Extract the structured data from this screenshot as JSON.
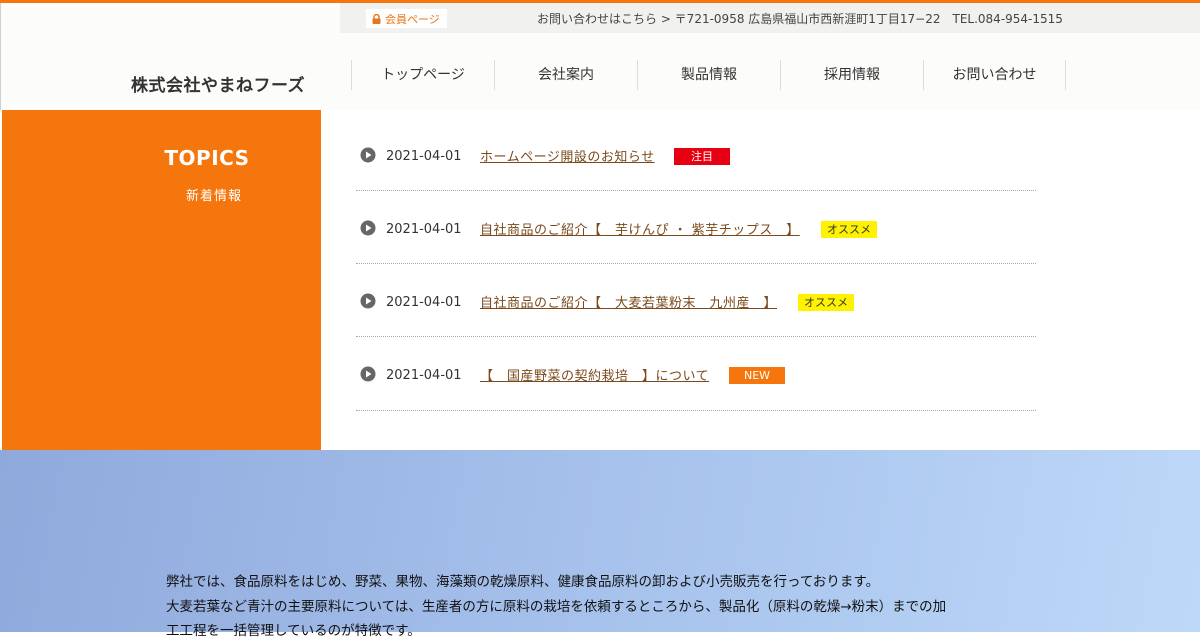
{
  "header": {
    "member_label": "会員ページ",
    "contact_text": "お問い合わせはこちら > 〒721-0958 広島県福山市西新涯町1丁目17−22　TEL.084-954-1515",
    "company_name": "株式会社やまねフーズ",
    "nav": [
      "トップページ",
      "会社案内",
      "製品情報",
      "採用情報",
      "お問い合わせ"
    ]
  },
  "topics": {
    "title": "TOPICS",
    "subtitle": "新着情報",
    "items": [
      {
        "date": "2021-04-01",
        "title": "ホームページ開設のお知らせ",
        "badge": "注目",
        "badge_color": "#e60012"
      },
      {
        "date": "2021-04-01",
        "title": "自社商品のご紹介【　芋けんぴ ・ 紫芋チップス　】",
        "badge": "オススメ",
        "badge_color": "#fff200"
      },
      {
        "date": "2021-04-01",
        "title": "自社商品のご紹介【　大麦若葉粉末　九州産　】",
        "badge": "オススメ",
        "badge_color": "#fff200"
      },
      {
        "date": "2021-04-01",
        "title": "【　国産野菜の契約栽培　】について",
        "badge": "NEW",
        "badge_color": "#f5760d"
      }
    ]
  },
  "intro": {
    "lines": [
      "弊社では、食品原料をはじめ、野菜、果物、海藻類の乾燥原料、健康食品原料の卸および小売販売を行っております。",
      "大麦若葉など青汁の主要原料については、生産者の方に原料の栽培を依頼するところから、製品化（原料の乾燥→粉末）までの加",
      "工工程を一括管理しているのが特徴です。"
    ]
  },
  "colors": {
    "accent": "#f5760d",
    "link": "#7a4a1c"
  }
}
